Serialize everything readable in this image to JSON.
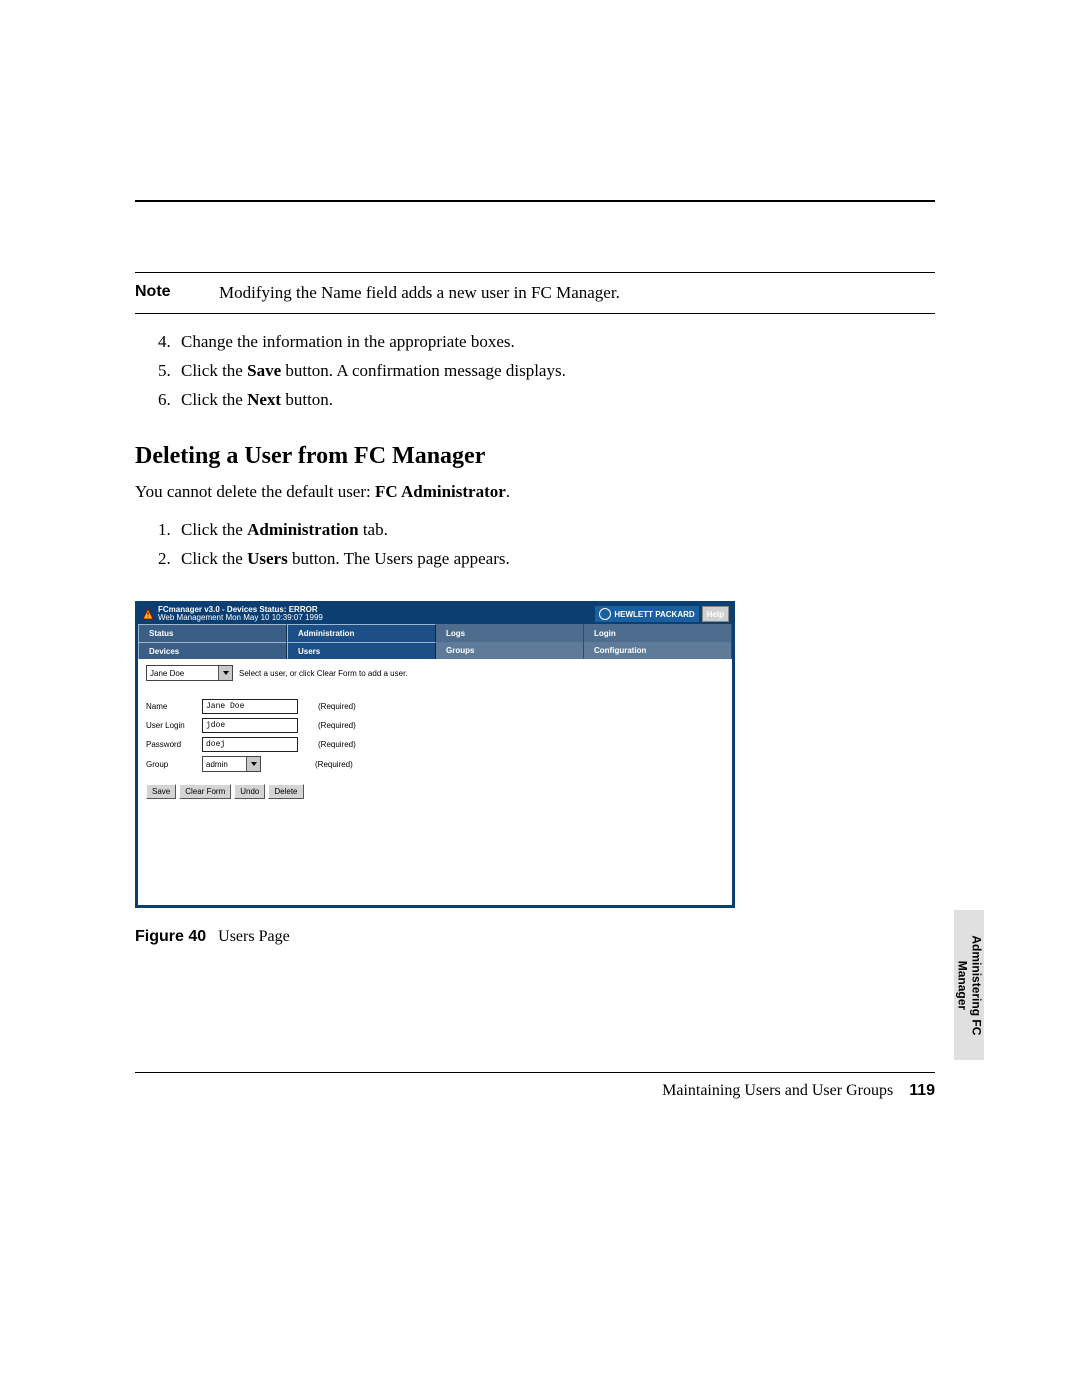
{
  "note": {
    "label": "Note",
    "text": "Modifying the Name field adds a new user in FC Manager."
  },
  "steps_a": [
    {
      "n": "4.",
      "pre": "Change the information in the appropriate boxes."
    },
    {
      "n": "5.",
      "pre": "Click the ",
      "bold": "Save",
      "post": " button. A confirmation message displays."
    },
    {
      "n": "6.",
      "pre": "Click the ",
      "bold": "Next",
      "post": " button."
    }
  ],
  "section_heading": "Deleting a User from FC Manager",
  "intro": {
    "pre": "You cannot delete the default user: ",
    "bold": "FC Administrator",
    "post": "."
  },
  "steps_b": [
    {
      "n": "1.",
      "pre": "Click the ",
      "bold": "Administration",
      "post": " tab."
    },
    {
      "n": "2.",
      "pre": "Click the ",
      "bold": "Users",
      "post": " button. The Users page appears."
    }
  ],
  "screenshot": {
    "title_line1": "FCmanager v3.0 - Devices Status: ERROR",
    "title_line2": "Web Management Mon May 10 10:39:07 1999",
    "hp_label": "HEWLETT PACKARD",
    "help": "Help",
    "tabs1": [
      "Status",
      "Administration",
      "Logs",
      "Login"
    ],
    "tabs2": [
      "Devices",
      "Users",
      "Groups",
      "Configuration"
    ],
    "user_select_value": "Jane Doe",
    "select_hint": "Select a user, or click Clear Form to add a user.",
    "fields": {
      "name": {
        "label": "Name",
        "value": "Jane Doe",
        "req": "(Required)"
      },
      "login": {
        "label": "User Login",
        "value": "jdoe",
        "req": "(Required)"
      },
      "password": {
        "label": "Password",
        "value": "doej",
        "req": "(Required)"
      },
      "group": {
        "label": "Group",
        "value": "admin",
        "req": "(Required)"
      }
    },
    "buttons": [
      "Save",
      "Clear Form",
      "Undo",
      "Delete"
    ]
  },
  "figure": {
    "label": "Figure 40",
    "caption": "Users Page"
  },
  "side_tab": "Administering FC Manager",
  "footer": {
    "text": "Maintaining Users and User Groups",
    "page": "119"
  }
}
